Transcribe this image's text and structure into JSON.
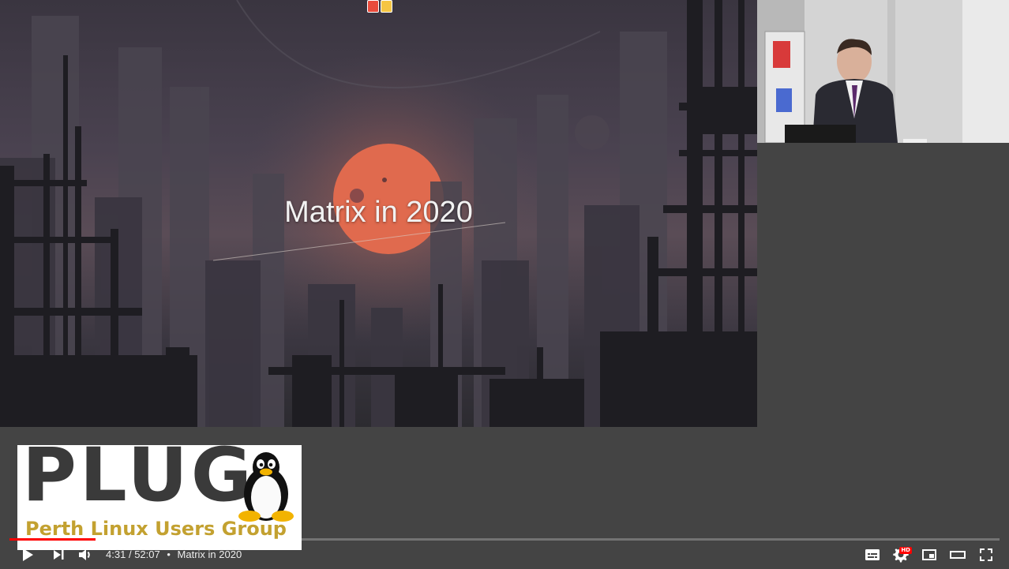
{
  "slide": {
    "title": "Matrix in 2020"
  },
  "logo": {
    "word": "PLUG",
    "subtitle": "Perth Linux Users Group"
  },
  "player": {
    "current_time": "4:31",
    "separator": "/",
    "duration": "52:07",
    "dot": "•",
    "chapter_title": "Matrix in 2020",
    "progress_played": 0.087,
    "progress_loaded": 0.12,
    "hd_badge": "HD",
    "colors": {
      "progress_played": "#ff0000",
      "hd_badge": "#ff0000",
      "background": "#444444"
    },
    "icons": {
      "play": "play-icon",
      "next": "next-icon",
      "volume": "volume-icon",
      "subtitles": "subtitles-icon",
      "settings": "settings-gear-icon",
      "miniplayer": "miniplayer-icon",
      "theater": "theater-mode-icon",
      "fullscreen": "fullscreen-icon"
    }
  }
}
